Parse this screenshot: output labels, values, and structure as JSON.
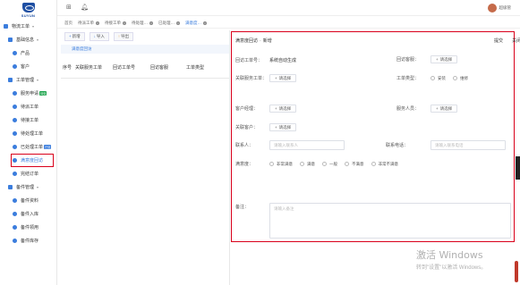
{
  "logo": {
    "text": "SUYUN"
  },
  "sidebar": {
    "items": [
      {
        "label": "物流工单",
        "level": 0
      },
      {
        "label": "基础信息",
        "level": 1
      },
      {
        "label": "产品",
        "level": 2
      },
      {
        "label": "客户",
        "level": 2
      },
      {
        "label": "工单管理",
        "level": 1
      },
      {
        "label": "服务申请",
        "level": 2,
        "badge": "待处"
      },
      {
        "label": "待派工单",
        "level": 2
      },
      {
        "label": "待接工单",
        "level": 2
      },
      {
        "label": "待处理工单",
        "level": 2
      },
      {
        "label": "已处理工单",
        "level": 2,
        "badge": "已处"
      },
      {
        "label": "满意度回访",
        "level": 2,
        "active": true
      },
      {
        "label": "完结订单",
        "level": 2
      },
      {
        "label": "备件管理",
        "level": 1
      },
      {
        "label": "备件资料",
        "level": 2
      },
      {
        "label": "备件入库",
        "level": 2
      },
      {
        "label": "备件领用",
        "level": 2
      },
      {
        "label": "备件库存",
        "level": 2
      }
    ]
  },
  "topbar": {
    "icons": [
      "grid-icon",
      "bell-icon"
    ],
    "username": "超级管"
  },
  "tabs": [
    {
      "label": "首页"
    },
    {
      "label": "待派工单"
    },
    {
      "label": "待接工单"
    },
    {
      "label": "待处理…"
    },
    {
      "label": "已处理…"
    },
    {
      "label": "满意度…",
      "active": true
    }
  ],
  "toolbar": {
    "new": "新增",
    "import": "导入",
    "export": "导出"
  },
  "subtab": "满意度回访",
  "table": {
    "columns": [
      "序号",
      "关联服务工单",
      "回访工单号",
      "回访客服",
      "工单类型"
    ]
  },
  "form": {
    "breadcrumb_a": "满意度回访",
    "breadcrumb_sep": "-",
    "breadcrumb_b": "新增",
    "submit": "提交",
    "close": "关闭",
    "fields": {
      "visit_no_label": "回访工单号：",
      "visit_no_value": "系统自动生成",
      "visit_staff_label": "回访客服：",
      "service_order_label": "关联服务工单：",
      "order_type_label": "工单类型：",
      "order_type_options": [
        "安装",
        "维修"
      ],
      "customer_mgr_label": "客户经理：",
      "service_staff_label": "服务人员：",
      "related_customer_label": "关联客户：",
      "contact_label": "联系人：",
      "contact_placeholder": "请输入联系人",
      "phone_label": "联系电话：",
      "phone_placeholder": "请输入联系电话",
      "satisfaction_label": "满意度：",
      "satisfaction_options": [
        "非常满意",
        "满意",
        "一般",
        "不满意",
        "非常不满意"
      ],
      "remark_label": "备注：",
      "remark_placeholder": "请输入备注",
      "select_btn": "请选择"
    }
  },
  "watermark": {
    "line1": "激活 Windows",
    "line2": "转到\"设置\"以激活 Windows。"
  }
}
